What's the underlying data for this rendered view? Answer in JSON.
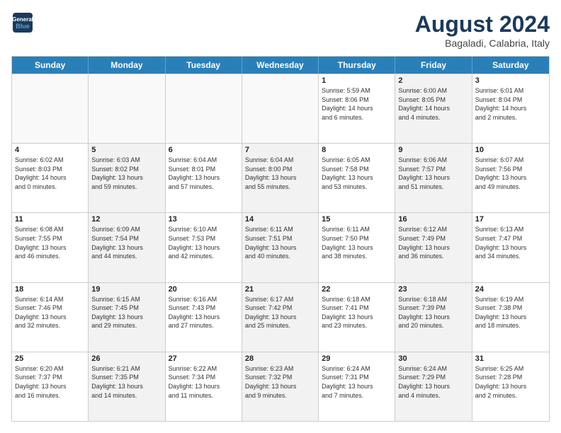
{
  "header": {
    "logo_line1": "General",
    "logo_line2": "Blue",
    "month": "August 2024",
    "location": "Bagaladi, Calabria, Italy"
  },
  "days_of_week": [
    "Sunday",
    "Monday",
    "Tuesday",
    "Wednesday",
    "Thursday",
    "Friday",
    "Saturday"
  ],
  "weeks": [
    [
      {
        "day": "",
        "text": "",
        "shaded": false,
        "empty": true
      },
      {
        "day": "",
        "text": "",
        "shaded": false,
        "empty": true
      },
      {
        "day": "",
        "text": "",
        "shaded": false,
        "empty": true
      },
      {
        "day": "",
        "text": "",
        "shaded": false,
        "empty": true
      },
      {
        "day": "1",
        "text": "Sunrise: 5:59 AM\nSunset: 8:06 PM\nDaylight: 14 hours\nand 6 minutes.",
        "shaded": false,
        "empty": false
      },
      {
        "day": "2",
        "text": "Sunrise: 6:00 AM\nSunset: 8:05 PM\nDaylight: 14 hours\nand 4 minutes.",
        "shaded": true,
        "empty": false
      },
      {
        "day": "3",
        "text": "Sunrise: 6:01 AM\nSunset: 8:04 PM\nDaylight: 14 hours\nand 2 minutes.",
        "shaded": false,
        "empty": false
      }
    ],
    [
      {
        "day": "4",
        "text": "Sunrise: 6:02 AM\nSunset: 8:03 PM\nDaylight: 14 hours\nand 0 minutes.",
        "shaded": false,
        "empty": false
      },
      {
        "day": "5",
        "text": "Sunrise: 6:03 AM\nSunset: 8:02 PM\nDaylight: 13 hours\nand 59 minutes.",
        "shaded": true,
        "empty": false
      },
      {
        "day": "6",
        "text": "Sunrise: 6:04 AM\nSunset: 8:01 PM\nDaylight: 13 hours\nand 57 minutes.",
        "shaded": false,
        "empty": false
      },
      {
        "day": "7",
        "text": "Sunrise: 6:04 AM\nSunset: 8:00 PM\nDaylight: 13 hours\nand 55 minutes.",
        "shaded": true,
        "empty": false
      },
      {
        "day": "8",
        "text": "Sunrise: 6:05 AM\nSunset: 7:58 PM\nDaylight: 13 hours\nand 53 minutes.",
        "shaded": false,
        "empty": false
      },
      {
        "day": "9",
        "text": "Sunrise: 6:06 AM\nSunset: 7:57 PM\nDaylight: 13 hours\nand 51 minutes.",
        "shaded": true,
        "empty": false
      },
      {
        "day": "10",
        "text": "Sunrise: 6:07 AM\nSunset: 7:56 PM\nDaylight: 13 hours\nand 49 minutes.",
        "shaded": false,
        "empty": false
      }
    ],
    [
      {
        "day": "11",
        "text": "Sunrise: 6:08 AM\nSunset: 7:55 PM\nDaylight: 13 hours\nand 46 minutes.",
        "shaded": false,
        "empty": false
      },
      {
        "day": "12",
        "text": "Sunrise: 6:09 AM\nSunset: 7:54 PM\nDaylight: 13 hours\nand 44 minutes.",
        "shaded": true,
        "empty": false
      },
      {
        "day": "13",
        "text": "Sunrise: 6:10 AM\nSunset: 7:53 PM\nDaylight: 13 hours\nand 42 minutes.",
        "shaded": false,
        "empty": false
      },
      {
        "day": "14",
        "text": "Sunrise: 6:11 AM\nSunset: 7:51 PM\nDaylight: 13 hours\nand 40 minutes.",
        "shaded": true,
        "empty": false
      },
      {
        "day": "15",
        "text": "Sunrise: 6:11 AM\nSunset: 7:50 PM\nDaylight: 13 hours\nand 38 minutes.",
        "shaded": false,
        "empty": false
      },
      {
        "day": "16",
        "text": "Sunrise: 6:12 AM\nSunset: 7:49 PM\nDaylight: 13 hours\nand 36 minutes.",
        "shaded": true,
        "empty": false
      },
      {
        "day": "17",
        "text": "Sunrise: 6:13 AM\nSunset: 7:47 PM\nDaylight: 13 hours\nand 34 minutes.",
        "shaded": false,
        "empty": false
      }
    ],
    [
      {
        "day": "18",
        "text": "Sunrise: 6:14 AM\nSunset: 7:46 PM\nDaylight: 13 hours\nand 32 minutes.",
        "shaded": false,
        "empty": false
      },
      {
        "day": "19",
        "text": "Sunrise: 6:15 AM\nSunset: 7:45 PM\nDaylight: 13 hours\nand 29 minutes.",
        "shaded": true,
        "empty": false
      },
      {
        "day": "20",
        "text": "Sunrise: 6:16 AM\nSunset: 7:43 PM\nDaylight: 13 hours\nand 27 minutes.",
        "shaded": false,
        "empty": false
      },
      {
        "day": "21",
        "text": "Sunrise: 6:17 AM\nSunset: 7:42 PM\nDaylight: 13 hours\nand 25 minutes.",
        "shaded": true,
        "empty": false
      },
      {
        "day": "22",
        "text": "Sunrise: 6:18 AM\nSunset: 7:41 PM\nDaylight: 13 hours\nand 23 minutes.",
        "shaded": false,
        "empty": false
      },
      {
        "day": "23",
        "text": "Sunrise: 6:18 AM\nSunset: 7:39 PM\nDaylight: 13 hours\nand 20 minutes.",
        "shaded": true,
        "empty": false
      },
      {
        "day": "24",
        "text": "Sunrise: 6:19 AM\nSunset: 7:38 PM\nDaylight: 13 hours\nand 18 minutes.",
        "shaded": false,
        "empty": false
      }
    ],
    [
      {
        "day": "25",
        "text": "Sunrise: 6:20 AM\nSunset: 7:37 PM\nDaylight: 13 hours\nand 16 minutes.",
        "shaded": false,
        "empty": false
      },
      {
        "day": "26",
        "text": "Sunrise: 6:21 AM\nSunset: 7:35 PM\nDaylight: 13 hours\nand 14 minutes.",
        "shaded": true,
        "empty": false
      },
      {
        "day": "27",
        "text": "Sunrise: 6:22 AM\nSunset: 7:34 PM\nDaylight: 13 hours\nand 11 minutes.",
        "shaded": false,
        "empty": false
      },
      {
        "day": "28",
        "text": "Sunrise: 6:23 AM\nSunset: 7:32 PM\nDaylight: 13 hours\nand 9 minutes.",
        "shaded": true,
        "empty": false
      },
      {
        "day": "29",
        "text": "Sunrise: 6:24 AM\nSunset: 7:31 PM\nDaylight: 13 hours\nand 7 minutes.",
        "shaded": false,
        "empty": false
      },
      {
        "day": "30",
        "text": "Sunrise: 6:24 AM\nSunset: 7:29 PM\nDaylight: 13 hours\nand 4 minutes.",
        "shaded": true,
        "empty": false
      },
      {
        "day": "31",
        "text": "Sunrise: 6:25 AM\nSunset: 7:28 PM\nDaylight: 13 hours\nand 2 minutes.",
        "shaded": false,
        "empty": false
      }
    ]
  ]
}
